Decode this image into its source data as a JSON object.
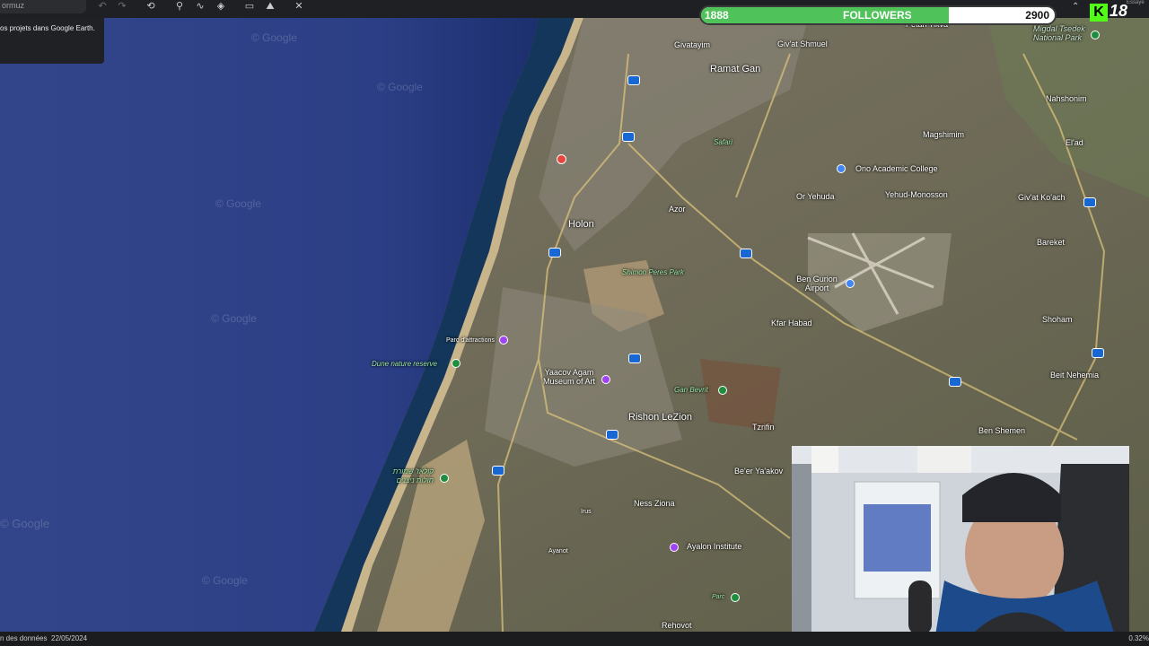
{
  "toolbar": {
    "search_value": "ormuz",
    "icons": [
      "undo-icon",
      "redo-icon",
      "history-icon",
      "placemark-icon",
      "path-icon",
      "layers-icon",
      "ruler-icon",
      "image-icon",
      "tools-icon"
    ]
  },
  "tooltip": {
    "text": "os projets dans Google Earth."
  },
  "followers": {
    "current": "1888",
    "label": "FOLLOWERS",
    "goal": "2900",
    "progress": 0.7
  },
  "stream": {
    "kick_number": "18",
    "corner_text": "Essaye"
  },
  "map": {
    "places": [
      {
        "name": "Givatayim",
        "kind": "place"
      },
      {
        "name": "Giv'at Shmuel",
        "kind": "place"
      },
      {
        "name": "Petah Tikva",
        "kind": "place"
      },
      {
        "name": "Ramat Gan",
        "kind": "city"
      },
      {
        "name": "Migdal Tsedek National Park",
        "kind": "green"
      },
      {
        "name": "Nahshonim",
        "kind": "place"
      },
      {
        "name": "Magshimim",
        "kind": "place"
      },
      {
        "name": "El'ad",
        "kind": "place"
      },
      {
        "name": "Safari",
        "kind": "green"
      },
      {
        "name": "Ono Academic College",
        "kind": "place"
      },
      {
        "name": "Or Yehuda",
        "kind": "place"
      },
      {
        "name": "Yehud-Monosson",
        "kind": "place"
      },
      {
        "name": "Giv'at Ko'ach",
        "kind": "place"
      },
      {
        "name": "Holon",
        "kind": "city"
      },
      {
        "name": "Azor",
        "kind": "place"
      },
      {
        "name": "Bareket",
        "kind": "place"
      },
      {
        "name": "Shimon Peres Park",
        "kind": "green"
      },
      {
        "name": "Ben Gurion Airport",
        "kind": "place"
      },
      {
        "name": "Kfar Habad",
        "kind": "place"
      },
      {
        "name": "Shoham",
        "kind": "place"
      },
      {
        "name": "Parc d'attractions",
        "kind": "place"
      },
      {
        "name": "Dune nature reserve",
        "kind": "green"
      },
      {
        "name": "Yaacov Agam Museum of Art",
        "kind": "place"
      },
      {
        "name": "Gan Bevrit",
        "kind": "green"
      },
      {
        "name": "Beit Nehemia",
        "kind": "place"
      },
      {
        "name": "Rishon LeZion",
        "kind": "city"
      },
      {
        "name": "Tzrifin",
        "kind": "place"
      },
      {
        "name": "Ben Shemen",
        "kind": "place"
      },
      {
        "name": "Be'er Ya'akov",
        "kind": "place"
      },
      {
        "name": "Ness Ziona",
        "kind": "place"
      },
      {
        "name": "Irus",
        "kind": "place"
      },
      {
        "name": "Ayanot",
        "kind": "place"
      },
      {
        "name": "Ayalon Institute",
        "kind": "place"
      },
      {
        "name": "Parc",
        "kind": "green"
      },
      {
        "name": "Rehovot",
        "kind": "place"
      }
    ],
    "hebrew_label": "קולאז' שמורת חולות ניצנים",
    "watermark": "© Google"
  },
  "status": {
    "data_text": "n des données",
    "date": "22/05/2024",
    "right_text": "0.32%"
  },
  "colors": {
    "sea": "#3a4a8c",
    "followers_fill": "#4fc35a",
    "kick_green": "#53fc18"
  }
}
